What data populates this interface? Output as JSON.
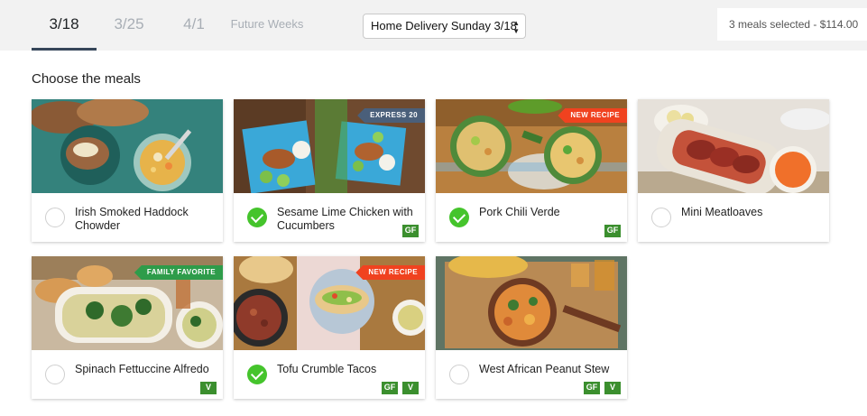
{
  "tabs": [
    {
      "label": "3/18",
      "active": true
    },
    {
      "label": "3/25",
      "active": false
    },
    {
      "label": "4/1",
      "active": false
    },
    {
      "label": "Future Weeks",
      "active": false
    }
  ],
  "delivery_select": {
    "value": "Home Delivery Sunday 3/18"
  },
  "summary": "3 meals selected - $114.00",
  "heading": "Choose the meals",
  "colors": {
    "accent_green": "#45c42c",
    "badge_green": "#3b8f2e",
    "new_recipe": "#f0421f",
    "express": "#4a5f7a",
    "tab_underline": "#36465a"
  },
  "meals": [
    {
      "name": "Irish Smoked Haddock Chowder",
      "selected": false,
      "ribbon": "",
      "badges": []
    },
    {
      "name": "Sesame Lime Chicken with Cucumbers",
      "selected": true,
      "ribbon": "EXPRESS 20",
      "badges": [
        "GF"
      ]
    },
    {
      "name": "Pork Chili Verde",
      "selected": true,
      "ribbon": "NEW RECIPE",
      "badges": [
        "GF"
      ]
    },
    {
      "name": "Mini Meatloaves",
      "selected": false,
      "ribbon": "",
      "badges": []
    },
    {
      "name": "Spinach Fettuccine Alfredo",
      "selected": false,
      "ribbon": "FAMILY FAVORITE",
      "badges": [
        "V"
      ]
    },
    {
      "name": "Tofu Crumble Tacos",
      "selected": true,
      "ribbon": "NEW RECIPE",
      "badges": [
        "GF",
        "V"
      ]
    },
    {
      "name": "West African Peanut Stew",
      "selected": false,
      "ribbon": "",
      "badges": [
        "GF",
        "V"
      ]
    }
  ]
}
